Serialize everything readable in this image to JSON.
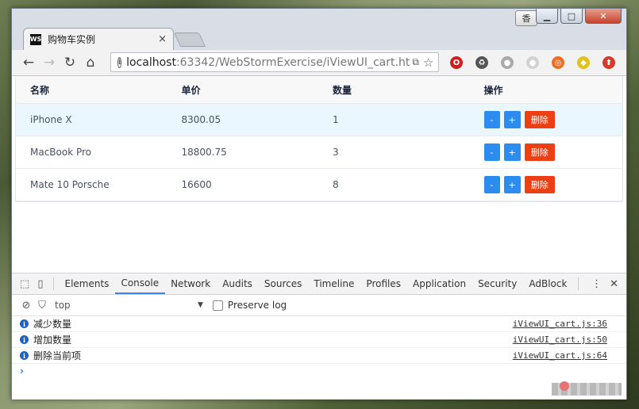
{
  "window": {
    "ime_label": "香",
    "minimize_label": "▁",
    "maximize_label": "□",
    "close_label": "✕"
  },
  "browser": {
    "tab": {
      "favicon_label": "WS",
      "title": "购物车实例",
      "close_label": "×"
    },
    "nav": {
      "back": "←",
      "forward": "→",
      "reload": "↻",
      "home": "⌂"
    },
    "url": {
      "info": "i",
      "host": "localhost",
      "path": ":63342/WebStormExercise/iViewUI_cart.ht",
      "translate": "⧉",
      "star": "☆"
    },
    "extensions": [
      {
        "name": "opera-icon",
        "color": "#cc1f1f",
        "glyph": "O"
      },
      {
        "name": "recycle-icon",
        "color": "#555555",
        "glyph": "♻"
      },
      {
        "name": "gray-extension-icon",
        "color": "#aaaaaa",
        "glyph": "●"
      },
      {
        "name": "faded-extension-icon",
        "color": "#d2d2d2",
        "glyph": "●"
      },
      {
        "name": "lifebuoy-icon",
        "color": "#f26c21",
        "glyph": "◎"
      },
      {
        "name": "yellow-extension-icon",
        "color": "#e0c21b",
        "glyph": "◆"
      },
      {
        "name": "upload-icon",
        "color": "#d43b2d",
        "glyph": "⬆"
      }
    ]
  },
  "cart": {
    "headers": [
      "名称",
      "单价",
      "数量",
      "操作"
    ],
    "rows": [
      {
        "name": "iPhone X",
        "price": "8300.05",
        "qty": "1"
      },
      {
        "name": "MacBook Pro",
        "price": "18800.75",
        "qty": "3"
      },
      {
        "name": "Mate 10 Porsche",
        "price": "16600",
        "qty": "8"
      }
    ],
    "buttons": {
      "minus": "-",
      "plus": "+",
      "delete": "删除"
    },
    "colors": {
      "blue": "#2d8cf0",
      "red": "#ed3f14"
    }
  },
  "devtools": {
    "tabs": [
      "Elements",
      "Console",
      "Network",
      "Audits",
      "Sources",
      "Timeline",
      "Profiles",
      "Application",
      "Security",
      "AdBlock"
    ],
    "active_tab": "Console",
    "context": "top",
    "preserve_log": "Preserve log",
    "messages": [
      {
        "text": "减少数量",
        "source": "iViewUI_cart.js:36"
      },
      {
        "text": "增加数量",
        "source": "iViewUI_cart.js:50"
      },
      {
        "text": "删除当前项",
        "source": "iViewUI_cart.js:64"
      }
    ],
    "prompt": "›"
  }
}
